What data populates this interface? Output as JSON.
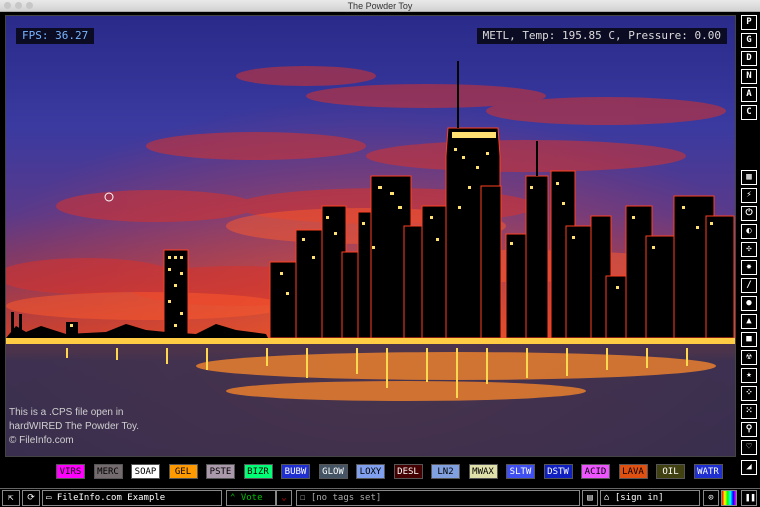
{
  "window": {
    "title": "The Powder Toy"
  },
  "hud": {
    "fps": "FPS: 36.27",
    "info": "METL, Temp: 195.85 C, Pressure: 0.00"
  },
  "overlay": {
    "line1": "This is a .CPS file open in",
    "line2": "hardWIRED The Powder Toy.",
    "line3": "© FileInfo.com"
  },
  "side_top": [
    "P",
    "G",
    "D",
    "N",
    "A",
    "C"
  ],
  "side_tools": [
    "wall-icon",
    "electronics-icon",
    "power-icon",
    "sensor-icon",
    "force-icon",
    "explosive-icon",
    "gas-icon",
    "liquid-icon",
    "powder-icon",
    "solid-icon",
    "radioactive-icon",
    "special-icon",
    "particles-icon",
    "life-icon",
    "tools-icon",
    "favorites-icon"
  ],
  "elements": [
    {
      "label": "VIRS",
      "bg": "#ff00ff",
      "fg": "#000000"
    },
    {
      "label": "MERC",
      "bg": "#736b6d",
      "fg": "#000000"
    },
    {
      "label": "SOAP",
      "bg": "#ffffff",
      "fg": "#000000"
    },
    {
      "label": "GEL",
      "bg": "#ff9900",
      "fg": "#000000"
    },
    {
      "label": "PSTE",
      "bg": "#aa99aa",
      "fg": "#000000"
    },
    {
      "label": "BIZR",
      "bg": "#00ff77",
      "fg": "#000000"
    },
    {
      "label": "BUBW",
      "bg": "#2030d0",
      "fg": "#ffffff"
    },
    {
      "label": "GLOW",
      "bg": "#445464",
      "fg": "#ffffff"
    },
    {
      "label": "LOXY",
      "bg": "#80a0ef",
      "fg": "#000000"
    },
    {
      "label": "DESL",
      "bg": "#440000",
      "fg": "#ffffff"
    },
    {
      "label": "LN2",
      "bg": "#80a0df",
      "fg": "#000000"
    },
    {
      "label": "MWAX",
      "bg": "#e0e0aa",
      "fg": "#000000"
    },
    {
      "label": "SLTW",
      "bg": "#4050f0",
      "fg": "#ffffff"
    },
    {
      "label": "DSTW",
      "bg": "#1020c0",
      "fg": "#ffffff"
    },
    {
      "label": "ACID",
      "bg": "#ed55ff",
      "fg": "#000000"
    },
    {
      "label": "LAVA",
      "bg": "#e05010",
      "fg": "#000000"
    },
    {
      "label": "OIL",
      "bg": "#404010",
      "fg": "#ffffff"
    },
    {
      "label": "WATR",
      "bg": "#2030d0",
      "fg": "#ffffff"
    }
  ],
  "bottom": {
    "save_name": "FileInfo.com Example",
    "vote_label": "Vote",
    "tags": "[no tags set]",
    "signin": "[sign in]"
  },
  "colors": {
    "accent": "#79b6ff",
    "vote": "#00c000",
    "downvote": "#c00000"
  }
}
